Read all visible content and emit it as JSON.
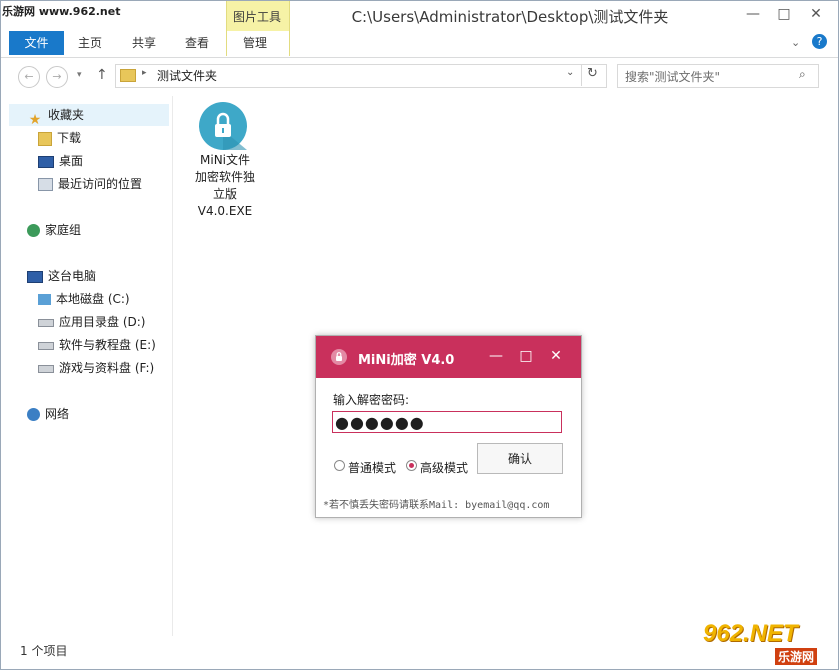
{
  "watermark_top": "乐游网 www.962.net",
  "window": {
    "title": "C:\\Users\\Administrator\\Desktop\\测试文件夹",
    "minimize": "—",
    "maximize": "□",
    "close": "✕"
  },
  "ribbon": {
    "context_group": "图片工具",
    "tabs": [
      "文件",
      "主页",
      "共享",
      "查看",
      "管理"
    ],
    "help": "?"
  },
  "address": {
    "path": "测试文件夹",
    "search_placeholder": "搜索\"测试文件夹\""
  },
  "sidebar": {
    "favorites": "收藏夹",
    "fav_items": [
      "下载",
      "桌面",
      "最近访问的位置"
    ],
    "homegroup": "家庭组",
    "computer": "这台电脑",
    "drives": [
      "本地磁盘 (C:)",
      "应用目录盘 (D:)",
      "软件与教程盘 (E:)",
      "游戏与资料盘 (F:)"
    ],
    "network": "网络"
  },
  "content": {
    "file_name_lines": [
      "MiNi文件",
      "加密软件独",
      "立版",
      "V4.0.EXE"
    ]
  },
  "status": {
    "items": "1 个项目"
  },
  "dialog": {
    "title": "MiNi加密 V4.0",
    "password_label": "输入解密密码:",
    "password_value": "●●●●●●",
    "mode_normal": "普通模式",
    "mode_advanced": "高级模式",
    "mode_selected": "高级模式",
    "confirm": "确认",
    "footer": "*若不慎丢失密码请联系Mail: byemail@qq.com",
    "accent": "#c9305c"
  },
  "corner_logo": {
    "text": "962.NET",
    "sub": "乐游网"
  }
}
